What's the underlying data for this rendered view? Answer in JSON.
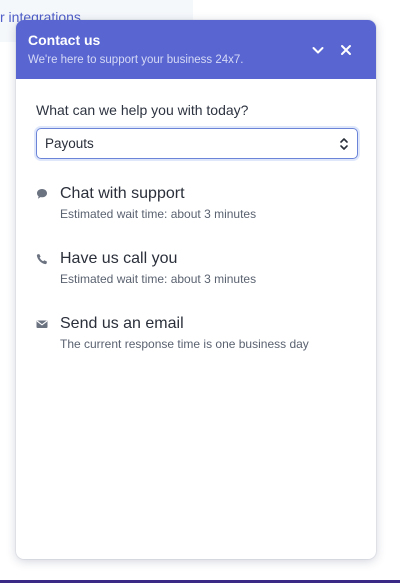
{
  "background": {
    "link_text": "r integrations"
  },
  "widget": {
    "title": "Contact us",
    "subtitle": "We're here to support your business 24x7.",
    "header_color": "#5966d2",
    "question": "What can we help you with today?",
    "select": {
      "value": "Payouts"
    },
    "options": [
      {
        "icon": "chat-bubble-icon",
        "title": "Chat with support",
        "subtitle": "Estimated wait time: about 3 minutes"
      },
      {
        "icon": "phone-icon",
        "title": "Have us call you",
        "subtitle": "Estimated wait time: about 3 minutes"
      },
      {
        "icon": "mail-icon",
        "title": "Send us an email",
        "subtitle": "The current response time is one business day"
      }
    ]
  }
}
